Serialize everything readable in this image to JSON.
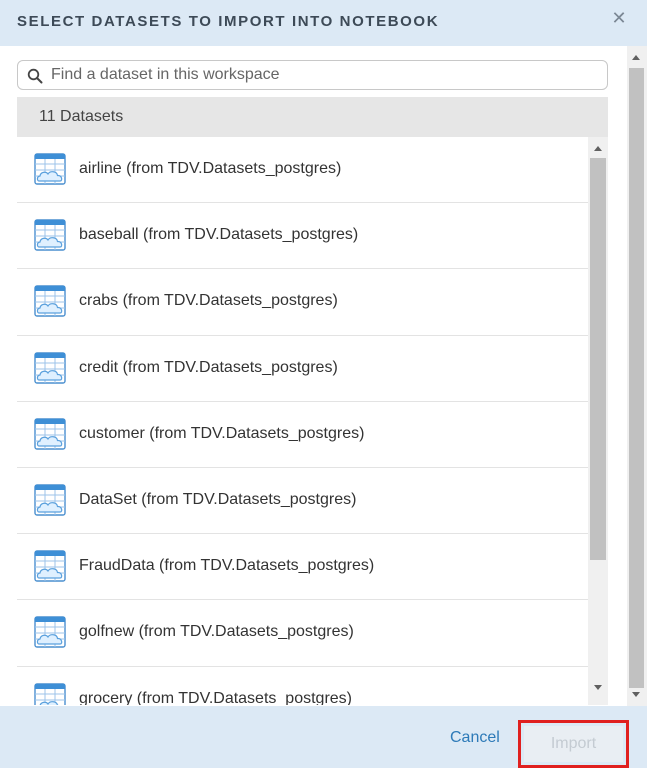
{
  "dialog": {
    "title": "SELECT DATASETS TO IMPORT INTO NOTEBOOK",
    "close_icon": "close-icon"
  },
  "search": {
    "placeholder": "Find a dataset in this workspace",
    "value": "",
    "icon": "search-icon"
  },
  "list": {
    "count_label": "11 Datasets",
    "item_icon": "dataset-cloud-icon",
    "items": [
      {
        "label": "airline (from TDV.Datasets_postgres)"
      },
      {
        "label": "baseball (from TDV.Datasets_postgres)"
      },
      {
        "label": "crabs (from TDV.Datasets_postgres)"
      },
      {
        "label": "credit (from TDV.Datasets_postgres)"
      },
      {
        "label": "customer (from TDV.Datasets_postgres)"
      },
      {
        "label": "DataSet (from TDV.Datasets_postgres)"
      },
      {
        "label": "FraudData (from TDV.Datasets_postgres)"
      },
      {
        "label": "golfnew (from TDV.Datasets_postgres)"
      },
      {
        "label": "grocery (from TDV.Datasets_postgres)"
      }
    ]
  },
  "footer": {
    "cancel_label": "Cancel",
    "import_label": "Import"
  },
  "colors": {
    "header_bg": "#dce9f5",
    "link": "#2d7ab8",
    "highlight_border": "#e0201f",
    "icon_blue": "#3e8fd6"
  }
}
